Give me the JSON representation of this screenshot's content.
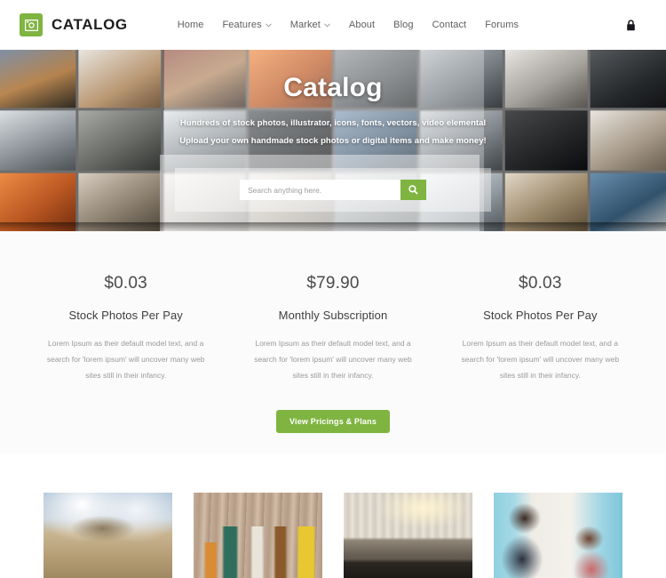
{
  "accent_color": "#7fb441",
  "header": {
    "brand": {
      "name": "CATALOG",
      "icon": "image-logo-icon"
    },
    "nav": [
      {
        "label": "Home",
        "has_caret": false
      },
      {
        "label": "Features",
        "has_caret": true
      },
      {
        "label": "Market",
        "has_caret": true
      },
      {
        "label": "About",
        "has_caret": false
      },
      {
        "label": "Blog",
        "has_caret": false
      },
      {
        "label": "Contact",
        "has_caret": false
      },
      {
        "label": "Forums",
        "has_caret": false
      }
    ],
    "right_icon": "lock-icon"
  },
  "hero": {
    "title": "Catalog",
    "subtitle": "Hundreds of stock photos, illustrator, icons, fonts, vectors, video elemental Upload your own handmade stock photos or digital items and make money!",
    "search": {
      "value": "",
      "placeholder": "Search anything here.",
      "button_icon": "search-icon"
    }
  },
  "pricing": {
    "columns": [
      {
        "amount": "$0.03",
        "label": "Stock Photos Per Pay",
        "description": "Lorem Ipsum as their default model text, and a search for 'lorem ipsum' will uncover many web sites still in their infancy."
      },
      {
        "amount": "$79.90",
        "label": "Monthly Subscription",
        "description": "Lorem Ipsum as their default model text, and a search for 'lorem ipsum' will uncover many web sites still in their infancy."
      },
      {
        "amount": "$0.03",
        "label": "Stock Photos Per Pay",
        "description": "Lorem Ipsum as their default model text, and a search for 'lorem ipsum' will uncover many web sites still in their infancy."
      }
    ],
    "cta_label": "View Pricings & Plans"
  },
  "gallery": {
    "items": [
      {
        "name": "hillside-town-photo"
      },
      {
        "name": "garden-tools-photo"
      },
      {
        "name": "hotel-bedroom-photo"
      },
      {
        "name": "hairdresser-photo"
      }
    ]
  }
}
